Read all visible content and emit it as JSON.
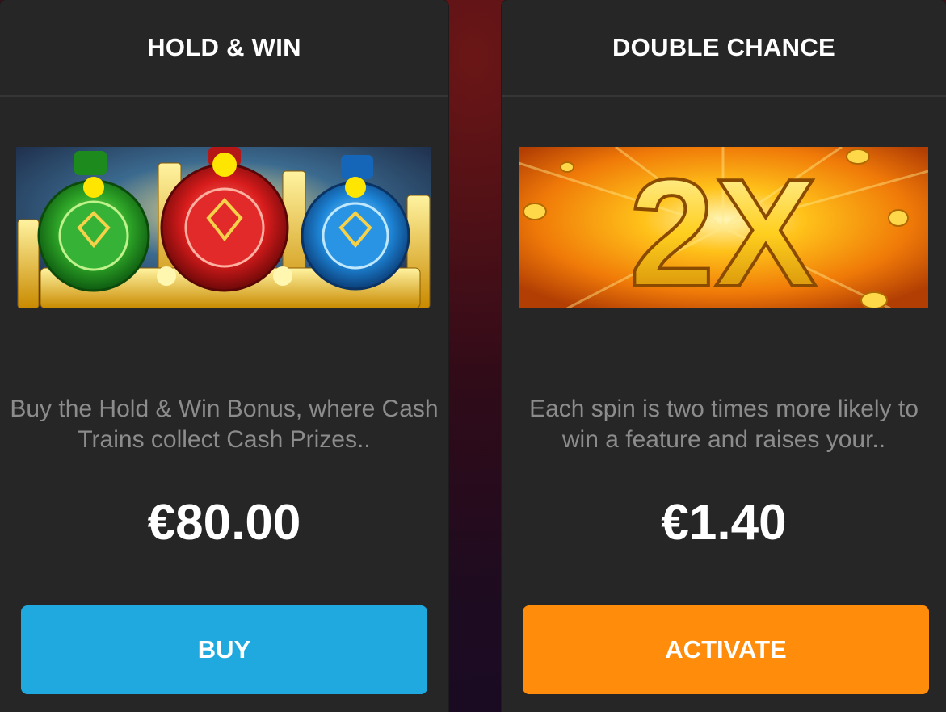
{
  "cards": [
    {
      "title": "HOLD & WIN",
      "description": "Buy the Hold & Win Bonus, where Cash Trains collect Cash Prizes..",
      "price": "€80.00",
      "button_label": "BUY",
      "button_color": "#1fa9df",
      "image_icon": "cash-trains-image"
    },
    {
      "title": "DOUBLE CHANCE",
      "description": "Each spin is two times more likely to win a feature and raises your..",
      "price": "€1.40",
      "button_label": "ACTIVATE",
      "button_color": "#ff8c0a",
      "image_icon": "2x-multiplier-image",
      "image_text": "2X"
    }
  ]
}
